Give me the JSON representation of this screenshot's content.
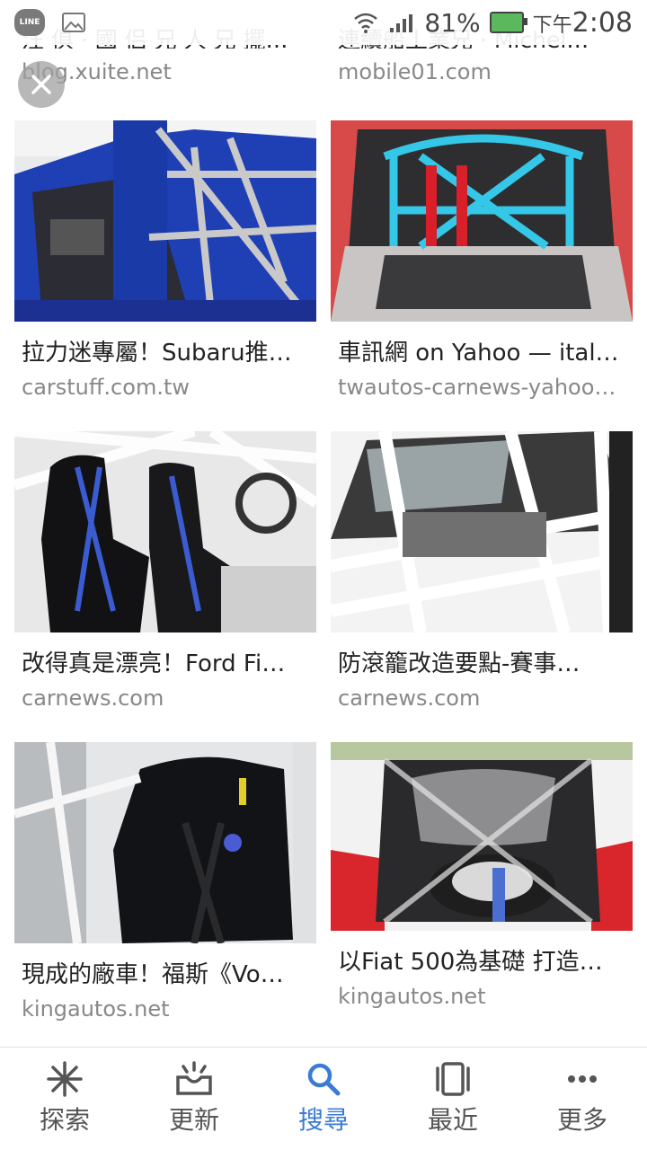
{
  "status_bar": {
    "line_badge": "LINE",
    "signal_text": ".ıll",
    "battery_percent": "81%",
    "time_prefix": "下午",
    "time": "2:08"
  },
  "top_partial": {
    "left_title": "汪 俱 · 國 侣 兄 人 兄 擺…",
    "left_source": "blog.xuite.net",
    "right_title": "連續船丄業兄 · Michel…",
    "right_source": "mobile01.com"
  },
  "results": [
    {
      "title": "拉力迷專屬！Subaru推…",
      "source": "carstuff.com.tw"
    },
    {
      "title": "車訊網 on Yahoo — ital…",
      "source": "twautos-carnews-yahoo…"
    },
    {
      "title": "改得真是漂亮！Ford Fi…",
      "source": "carnews.com"
    },
    {
      "title": "防滾籠改造要點-賽事…",
      "source": "carnews.com"
    },
    {
      "title": "現成的廠車！福斯《Vo…",
      "source": "kingautos.net"
    },
    {
      "title": "以Fiat 500為基礎 打造…",
      "source": "kingautos.net"
    }
  ],
  "bottom_nav": [
    {
      "label": "探索",
      "icon": "sparkle-icon"
    },
    {
      "label": "更新",
      "icon": "inbox-bell-icon"
    },
    {
      "label": "搜尋",
      "icon": "search-icon",
      "active": true
    },
    {
      "label": "最近",
      "icon": "recent-cards-icon"
    },
    {
      "label": "更多",
      "icon": "more-dots-icon"
    }
  ],
  "colors": {
    "accent": "#3a7bd5",
    "source_text": "#888888"
  }
}
